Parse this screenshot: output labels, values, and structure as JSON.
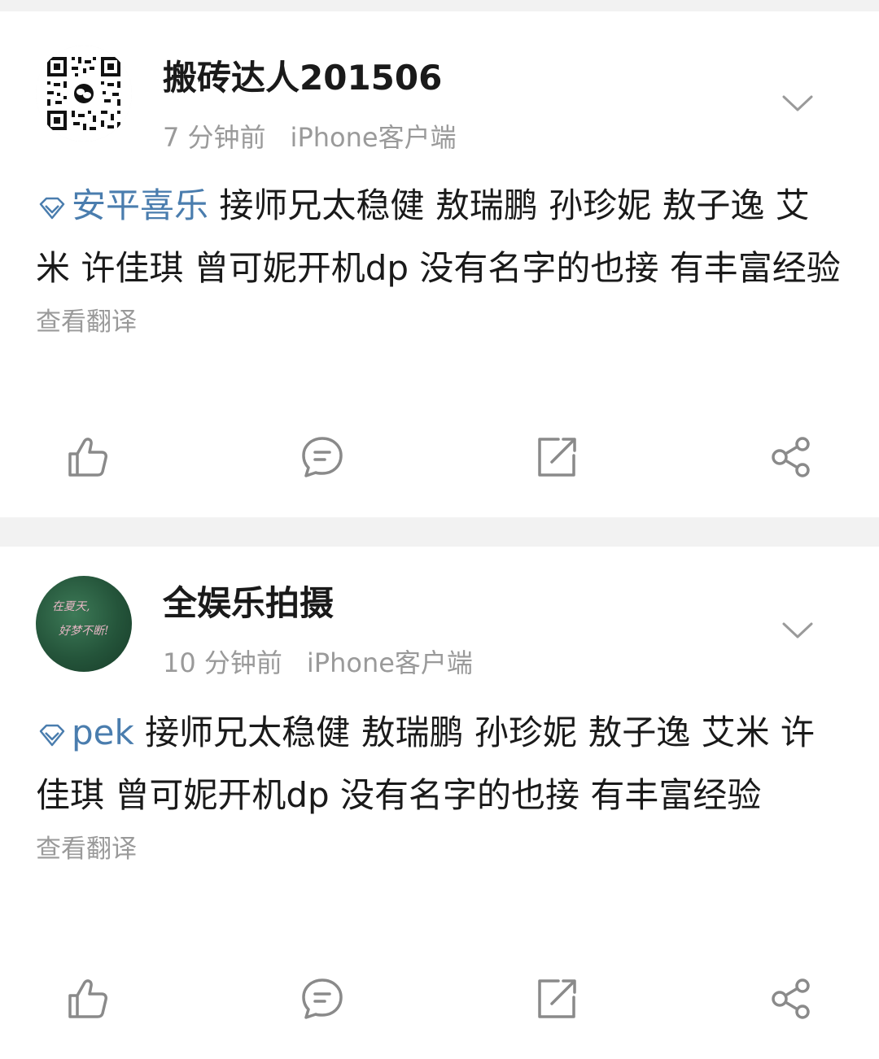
{
  "posts": [
    {
      "username": "搬砖达人201506",
      "time": "7 分钟前",
      "source": "iPhone客户端",
      "topic": "安平喜乐",
      "body": " 接师兄太稳健 敖瑞鹏 孙珍妮 敖子逸 艾米 许佳琪 曾可妮开机dp 没有名字的也接 有丰富经验",
      "translate": "查看翻译"
    },
    {
      "username": "全娱乐拍摄",
      "time": "10 分钟前",
      "source": "iPhone客户端",
      "topic": "pek",
      "body": " 接师兄太稳健 敖瑞鹏 孙珍妮 敖子逸 艾米 许佳琪 曾可妮开机dp 没有名字的也接 有丰富经验",
      "translate": "查看翻译",
      "avatar_text": [
        "在夏天,",
        "好梦不断!"
      ]
    }
  ],
  "icons": {
    "like": "thumbs-up-icon",
    "comment": "comment-icon",
    "repost": "repost-icon",
    "share": "share-icon",
    "more": "chevron-down-icon",
    "topic": "diamond-icon"
  },
  "colors": {
    "topic": "#4a7dae",
    "meta": "#9a9a9a",
    "icon": "#8a8a8a",
    "background": "#f2f2f2"
  }
}
